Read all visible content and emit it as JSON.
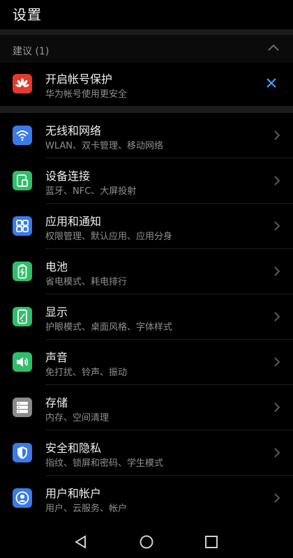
{
  "header": {
    "title": "设置"
  },
  "suggestions": {
    "title": "建议 (1)",
    "card": {
      "title": "开启帐号保护",
      "subtitle": "华为帐号使用更安全",
      "icon": "huawei-logo-icon",
      "icon_color": "#e33a2c"
    }
  },
  "settings": [
    {
      "title": "无线和网络",
      "subtitle": "WLAN、双卡管理、移动网络",
      "icon": "wifi-icon",
      "color": "#3b7be7"
    },
    {
      "title": "设备连接",
      "subtitle": "蓝牙、NFC、大屏投射",
      "icon": "device-connect-icon",
      "color": "#2fbf6a"
    },
    {
      "title": "应用和通知",
      "subtitle": "权限管理、默认应用、应用分身",
      "icon": "apps-icon",
      "color": "#3b7be7"
    },
    {
      "title": "电池",
      "subtitle": "省电模式、耗电排行",
      "icon": "battery-icon",
      "color": "#2fbf6a"
    },
    {
      "title": "显示",
      "subtitle": "护眼模式、桌面风格、字体样式",
      "icon": "display-icon",
      "color": "#2fbf6a"
    },
    {
      "title": "声音",
      "subtitle": "免打扰、铃声、振动",
      "icon": "sound-icon",
      "color": "#2fbf6a"
    },
    {
      "title": "存储",
      "subtitle": "内存、空间清理",
      "icon": "storage-icon",
      "color": "#8b8b8b"
    },
    {
      "title": "安全和隐私",
      "subtitle": "指纹、锁屏和密码、学生模式",
      "icon": "shield-icon",
      "color": "#3b7be7"
    },
    {
      "title": "用户和帐户",
      "subtitle": "用户、云服务、帐户",
      "icon": "user-icon",
      "color": "#3b7be7"
    }
  ],
  "colors": {
    "accent_blue": "#3aa0ff",
    "text_primary": "#efefef",
    "text_secondary": "#8f8f8f"
  }
}
